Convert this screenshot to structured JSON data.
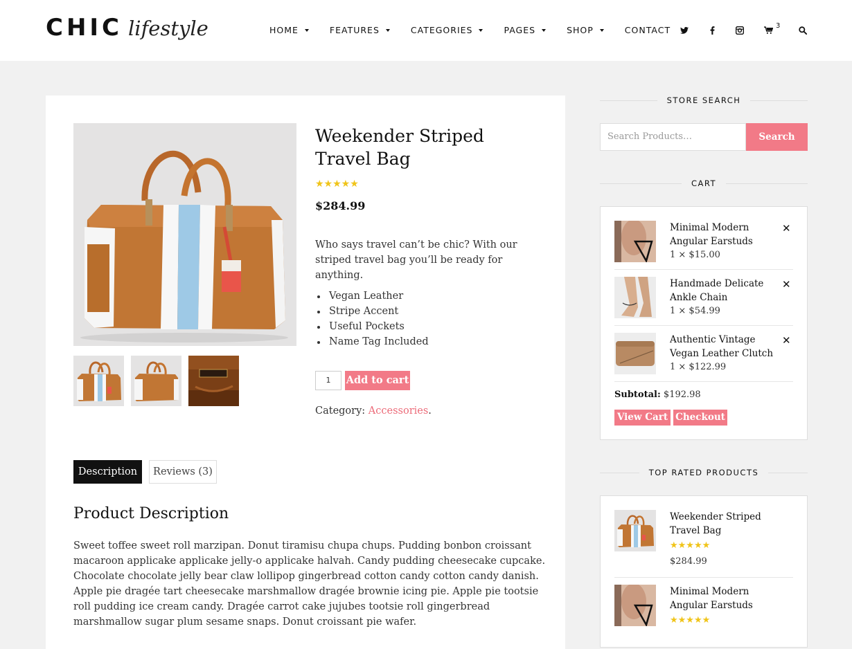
{
  "brand": {
    "main": "CHIC",
    "script": "lifestyle"
  },
  "nav": {
    "items": [
      {
        "label": "HOME",
        "caret": true
      },
      {
        "label": "FEATURES",
        "caret": true
      },
      {
        "label": "CATEGORIES",
        "caret": true
      },
      {
        "label": "PAGES",
        "caret": true
      },
      {
        "label": "SHOP",
        "caret": true
      },
      {
        "label": "CONTACT",
        "caret": false
      }
    ],
    "icons": [
      "twitter-icon",
      "facebook-icon",
      "instagram-icon",
      "cart-icon",
      "search-icon"
    ],
    "cart_count": "3"
  },
  "product": {
    "title": "Weekender Striped Travel Bag",
    "rating": 5,
    "price": "$284.99",
    "short_description": "Who says travel can’t be chic? With our striped travel bag you’ll be ready for anything.",
    "features": [
      "Vegan Leather",
      "Stripe Accent",
      "Useful Pockets",
      "Name Tag Included"
    ],
    "quantity": "1",
    "add_to_cart_label": "Add to cart",
    "category_label": "Category:",
    "category_value": "Accessories",
    "category_suffix": "."
  },
  "tabs": {
    "description": "Description",
    "reviews": "Reviews (3)"
  },
  "description": {
    "heading": "Product Description",
    "body": "Sweet toffee sweet roll marzipan. Donut tiramisu chupa chups. Pudding bonbon croissant macaroon applicake applicake jelly-o applicake halvah. Candy pudding cheesecake cupcake. Chocolate chocolate jelly bear claw lollipop gingerbread cotton candy cotton candy danish. Apple pie dragée tart cheesecake marshmallow dragée brownie icing pie. Apple pie tootsie roll pudding ice cream candy. Dragée carrot cake jujubes tootsie roll gingerbread marshmallow sugar plum sesame snaps. Donut croissant pie wafer."
  },
  "sidebar": {
    "search_title": "STORE SEARCH",
    "search_placeholder": "Search Products…",
    "search_button": "Search",
    "cart_title": "CART",
    "cart_items": [
      {
        "name": "Minimal Modern Angular Earstuds",
        "meta": "1 × $15.00"
      },
      {
        "name": "Handmade Delicate Ankle Chain",
        "meta": "1 × $54.99"
      },
      {
        "name": "Authentic Vintage Vegan Leather Clutch",
        "meta": "1 × $122.99"
      }
    ],
    "remove_symbol": "✕",
    "subtotal_label": "Subtotal:",
    "subtotal_value": "$192.98",
    "view_cart": "View Cart",
    "checkout": "Checkout",
    "top_title": "TOP RATED PRODUCTS",
    "top_items": [
      {
        "name": "Weekender Striped Travel Bag",
        "rating": 5,
        "price": "$284.99"
      },
      {
        "name": "Minimal Modern Angular Earstuds",
        "rating": 5
      }
    ]
  },
  "colors": {
    "accent": "#f27a87",
    "link": "#ec6a78",
    "star": "#f0c419",
    "dark": "#111111",
    "background": "#f1f1f1"
  }
}
